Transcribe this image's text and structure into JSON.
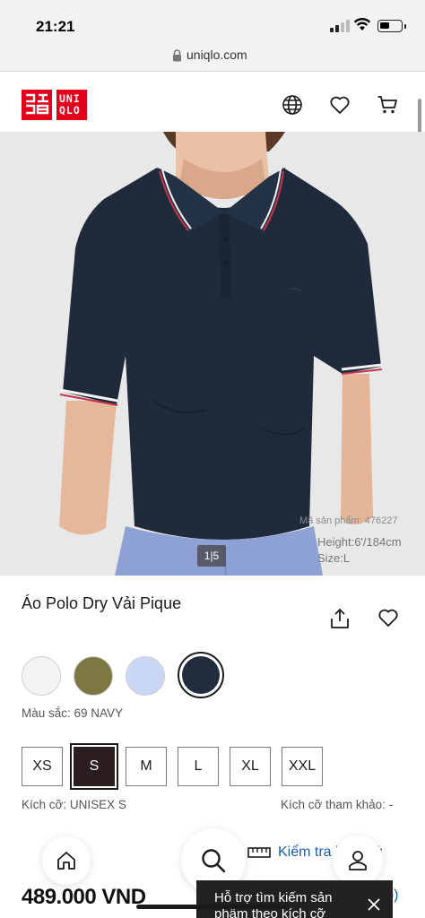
{
  "status_bar": {
    "time": "21:21"
  },
  "browser": {
    "url": "uniqlo.com"
  },
  "header": {
    "logo_top": "ユニクロ",
    "logo_bottom": "UNIQLO",
    "icons": [
      "globe-icon",
      "heart-icon",
      "cart-icon"
    ]
  },
  "hero": {
    "product_code_label": "Mã sản phẩm: 476227",
    "model_height": "Height:6'/184cm",
    "model_size": "Size:L",
    "pager": "1|5"
  },
  "product": {
    "title": "Áo Polo Dry Vải Pique",
    "colors": [
      {
        "name": "white",
        "hex": "#f4f4f4"
      },
      {
        "name": "olive",
        "hex": "#7d7842"
      },
      {
        "name": "light-blue",
        "hex": "#c9d7f4"
      },
      {
        "name": "navy",
        "hex": "#212d3d",
        "selected": true
      }
    ],
    "color_label": "Màu sắc: 69 NAVY",
    "sizes": [
      {
        "label": "XS"
      },
      {
        "label": "S",
        "selected": true
      },
      {
        "label": "M"
      },
      {
        "label": "L"
      },
      {
        "label": "XL"
      },
      {
        "label": "XXL"
      }
    ],
    "size_label": "Kích cỡ: UNISEX S",
    "size_reference": "Kích cỡ tham khảo: -",
    "size_guide": "Kiểm tra kích cỡ",
    "price": "489.000 VND",
    "rating_star": "★",
    "review_count": "(56)"
  },
  "tooltip": {
    "text": "Hỗ trợ tìm kiếm sản phẩm theo kích cỡ"
  }
}
